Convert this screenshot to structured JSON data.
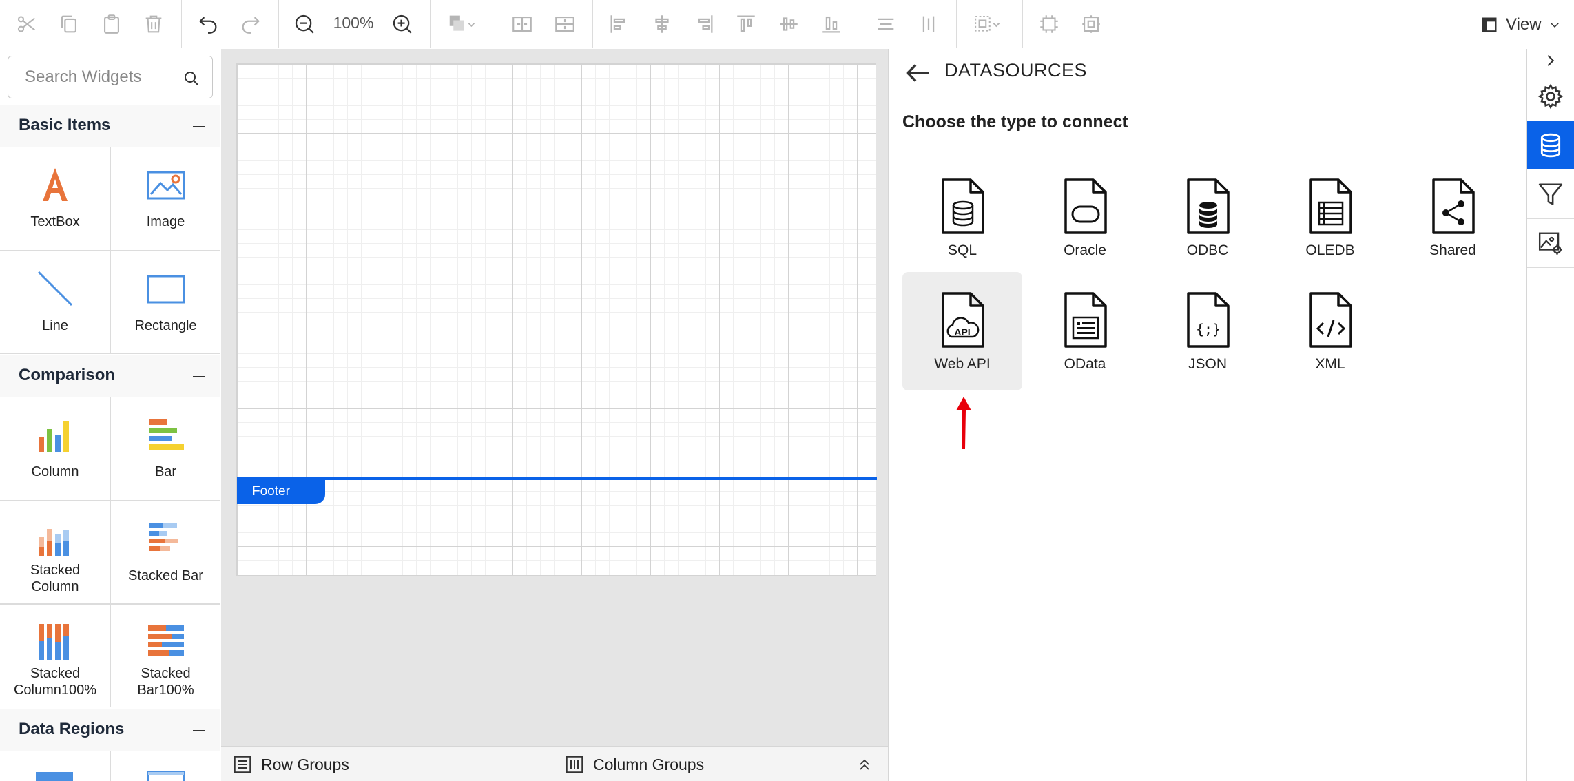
{
  "toolbar": {
    "zoom": "100%",
    "view_label": "View"
  },
  "search": {
    "placeholder": "Search Widgets"
  },
  "categories": {
    "basic": "Basic Items",
    "comparison": "Comparison",
    "data_regions": "Data Regions"
  },
  "widgets": {
    "textbox": "TextBox",
    "image": "Image",
    "line": "Line",
    "rectangle": "Rectangle",
    "column": "Column",
    "bar": "Bar",
    "stacked_column_l1": "Stacked",
    "stacked_column_l2": "Column",
    "stacked_bar": "Stacked Bar",
    "stacked_column100_l1": "Stacked",
    "stacked_column100_l2": "Column100%",
    "stacked_bar100_l1": "Stacked",
    "stacked_bar100_l2": "Bar100%"
  },
  "canvas": {
    "footer_label": "Footer"
  },
  "groups": {
    "row": "Row Groups",
    "column": "Column Groups"
  },
  "datasources": {
    "title": "DATASOURCES",
    "subtitle": "Choose the type to connect",
    "types": [
      "SQL",
      "Oracle",
      "ODBC",
      "OLEDB",
      "Shared",
      "Web API",
      "OData",
      "JSON",
      "XML"
    ],
    "selected": "Web API"
  },
  "colors": {
    "accent": "#0a62e8",
    "arrow": "#e8000b",
    "icon_orange": "#e8743b",
    "icon_blue": "#4a90e2",
    "icon_green": "#7dc242",
    "icon_yellow": "#f5d130"
  },
  "icons": {
    "right_strip": [
      "chevron-right-icon",
      "gear-icon",
      "database-icon",
      "filter-icon",
      "image-settings-icon"
    ]
  }
}
